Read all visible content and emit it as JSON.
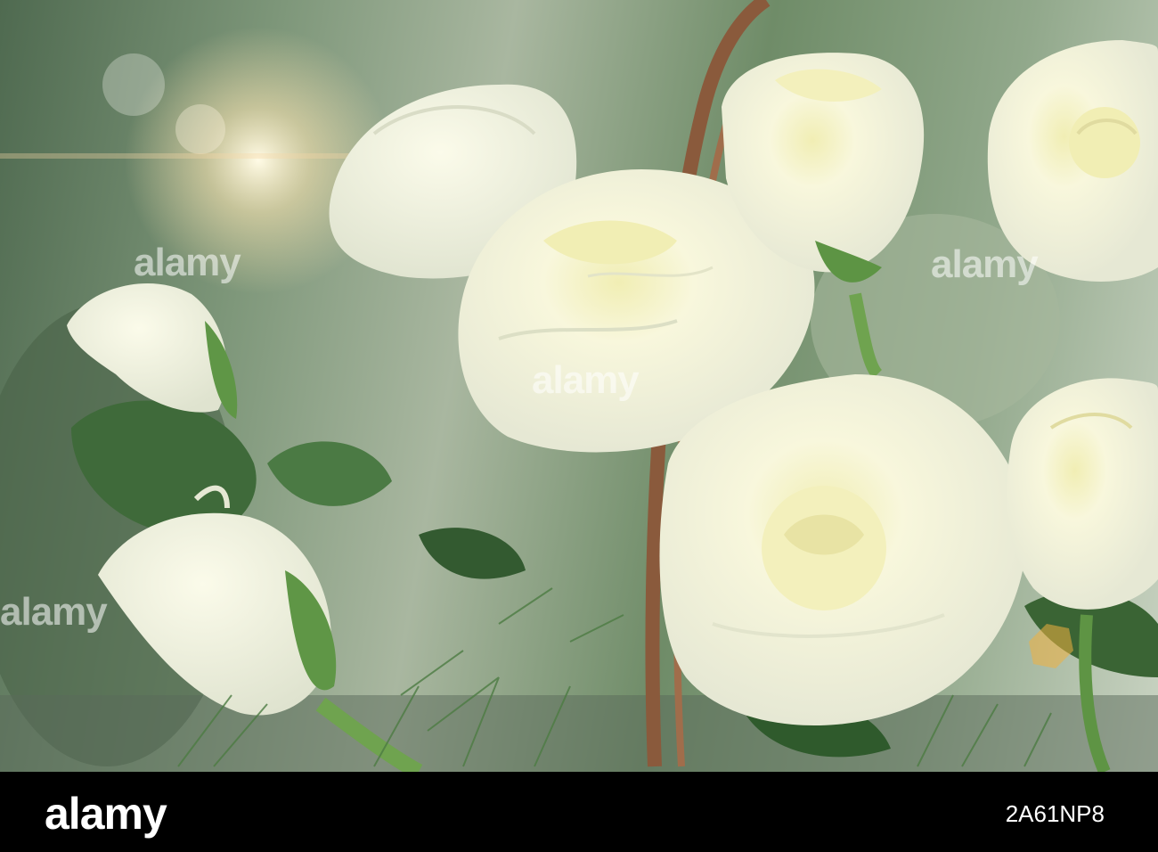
{
  "watermark": {
    "text": "alamy"
  },
  "footer": {
    "logo": "alamy",
    "image_id": "2A61NP8"
  },
  "colors": {
    "background_green": "#7e977a",
    "rose_white": "#fbfbe8",
    "rose_center": "#f1eeb4",
    "leaf": "#3f6a3a",
    "footer": "#000000"
  }
}
